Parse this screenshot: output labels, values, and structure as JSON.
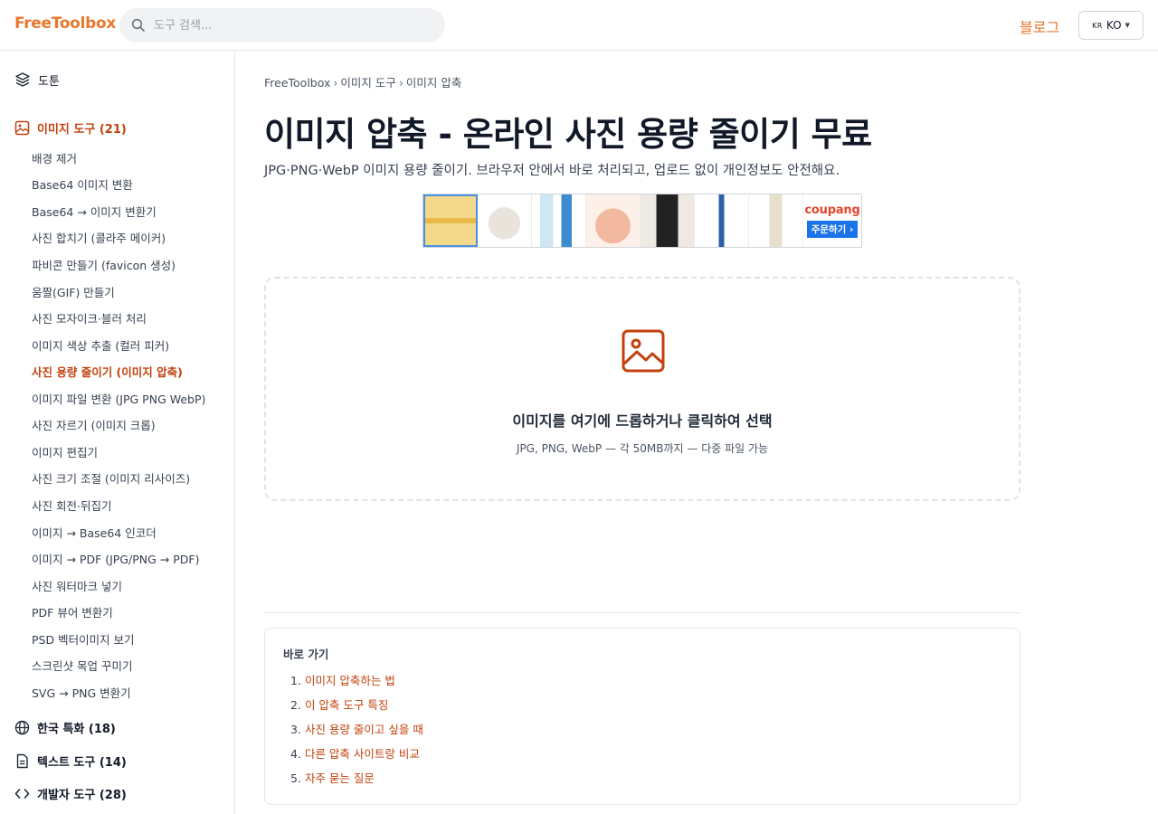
{
  "header": {
    "logo": "FreeToolbox",
    "search_placeholder": "도구 검색...",
    "blog_label": "블로그",
    "lang_flag": "KR",
    "lang_label": "KO"
  },
  "sidebar": {
    "top_item": "도툰",
    "active_category": "이미지 도구 (21)",
    "items": [
      "배경 제거",
      "Base64 이미지 변환",
      "Base64 → 이미지 변환기",
      "사진 합치기 (콜라주 메이커)",
      "파비콘 만들기 (favicon 생성)",
      "움짤(GIF) 만들기",
      "사진 모자이크·블러 처리",
      "이미지 색상 추출 (컬러 피커)",
      "사진 용량 줄이기 (이미지 압축)",
      "이미지 파일 변환 (JPG PNG WebP)",
      "사진 자르기 (이미지 크롭)",
      "이미지 편집기",
      "사진 크기 조절 (이미지 리사이즈)",
      "사진 회전·뒤집기",
      "이미지 → Base64 인코더",
      "이미지 → PDF (JPG/PNG → PDF)",
      "사진 워터마크 넣기",
      "PDF 뷰어 변환기",
      "PSD 벡터이미지 보기",
      "스크린샷 목업 꾸미기",
      "SVG → PNG 변환기"
    ],
    "active_item_index": 8,
    "categories": [
      {
        "label": "한국 특화 (18)",
        "icon": "globe-icon"
      },
      {
        "label": "텍스트 도구 (14)",
        "icon": "document-icon"
      },
      {
        "label": "개발자 도구 (28)",
        "icon": "code-icon"
      }
    ]
  },
  "breadcrumb": [
    "FreeToolbox",
    "이미지 도구",
    "이미지 압축"
  ],
  "page": {
    "title": "이미지 압축 - 온라인 사진 용량 줄이기 무료",
    "subtitle": "JPG·PNG·WebP 이미지 용량 줄이기. 브라우저 안에서 바로 처리되고, 업로드 없이 개인정보도 안전해요."
  },
  "ad": {
    "brand": "coupang",
    "button": "주문하기 ›"
  },
  "dropzone": {
    "title": "이미지를 여기에 드롭하거나 클릭하여 선택",
    "subtitle": "JPG, PNG, WebP — 각 50MB까지 — 다중 파일 가능"
  },
  "toc": {
    "title": "바로 가기",
    "items": [
      "이미지 압축하는 법",
      "이 압축 도구 특징",
      "사진 용량 줄이고 싶을 때",
      "다른 압축 사이트랑 비교",
      "자주 묻는 질문"
    ]
  },
  "colors": {
    "accent": "#e8772e",
    "active_text": "#c2410c",
    "ad_button": "#1a73e8"
  }
}
